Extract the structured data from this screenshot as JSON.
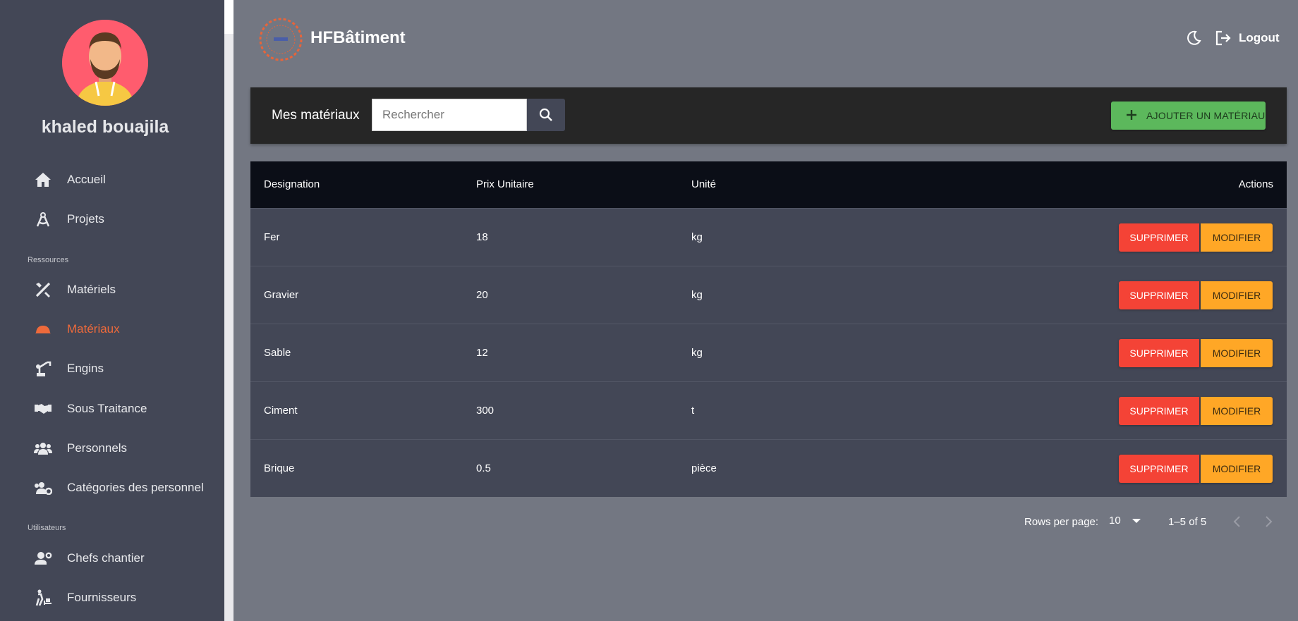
{
  "sidebar": {
    "user_name": "khaled bouajila",
    "items": [
      {
        "label": "Accueil",
        "icon": "home-icon",
        "active": false
      },
      {
        "label": "Projets",
        "icon": "compass-icon",
        "active": false
      },
      {
        "label": "Matériels",
        "icon": "tools-icon",
        "active": false
      },
      {
        "label": "Matériaux",
        "icon": "helmet-icon",
        "active": true
      },
      {
        "label": "Engins",
        "icon": "crane-icon",
        "active": false
      },
      {
        "label": "Sous Traitance",
        "icon": "handshake-icon",
        "active": false
      },
      {
        "label": "Personnels",
        "icon": "users-icon",
        "active": false
      },
      {
        "label": "Catégories des personnel",
        "icon": "users-cog-icon",
        "active": false
      },
      {
        "label": "Chefs chantier",
        "icon": "user-cog-icon",
        "active": false
      },
      {
        "label": "Fournisseurs",
        "icon": "dolly-icon",
        "active": false
      }
    ],
    "sections": {
      "resources": "Ressources",
      "users": "Utilisateurs"
    },
    "active_color": "#ee6a3b"
  },
  "header": {
    "brand": "HFBâtiment",
    "logout_label": "Logout"
  },
  "toolbar": {
    "title": "Mes matériaux",
    "search_placeholder": "Rechercher",
    "add_label": "AJOUTER UN MATÉRIAU"
  },
  "table": {
    "headers": {
      "designation": "Designation",
      "prix": "Prix Unitaire",
      "unite": "Unité",
      "actions": "Actions"
    },
    "rows": [
      {
        "designation": "Fer",
        "prix": "18",
        "unite": "kg"
      },
      {
        "designation": "Gravier",
        "prix": "20",
        "unite": "kg"
      },
      {
        "designation": "Sable",
        "prix": "12",
        "unite": "kg"
      },
      {
        "designation": "Ciment",
        "prix": "300",
        "unite": "t"
      },
      {
        "designation": "Brique",
        "prix": "0.5",
        "unite": "pièce"
      }
    ],
    "delete_label": "SUPPRIMER",
    "edit_label": "MODIFIER"
  },
  "pagination": {
    "rows_per_page_label": "Rows per page:",
    "rows_per_page": "10",
    "range": "1–5 of 5"
  },
  "colors": {
    "background": "#737782",
    "sidebar": "#434756",
    "toolbar": "#262626",
    "table_header": "#0b0e17",
    "add_button": "#5cb85c",
    "delete_button": "#f44336",
    "edit_button": "#ffa726"
  }
}
